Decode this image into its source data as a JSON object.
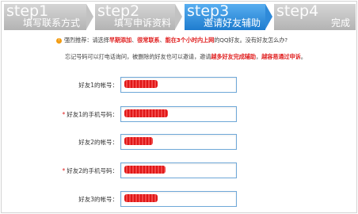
{
  "steps": [
    {
      "num": "step1",
      "label": "填写联系方式",
      "state": "done"
    },
    {
      "num": "step2",
      "label": "填写申诉资料",
      "state": "done"
    },
    {
      "num": "step3",
      "label": "邀请好友辅助",
      "state": "current"
    },
    {
      "num": "step4",
      "label": "完成",
      "state": "pending"
    }
  ],
  "tip": {
    "icon": "lightbulb-icon",
    "p1": "强烈推荐：请选择",
    "h1": "早期添加",
    "p2": "、",
    "h2": "很常联系",
    "p3": "、",
    "h3": "能在3个小时内上网",
    "p4": "的QQ好友。没有好友怎么办?"
  },
  "note": {
    "p1": "忘记号码可以打电话询问，被删除的好友也可以邀请，邀请",
    "h1": "越多好友完成辅助",
    "p2": "，",
    "h2": "越容易通过申诉",
    "p3": "。"
  },
  "form": [
    {
      "label": "好友1的帐号：",
      "required": false,
      "value": "●●●●●●●●●"
    },
    {
      "label": "好友1的手机号码：",
      "required": true,
      "value": "●●●●●●●●●●●"
    },
    {
      "label": "好友2的帐号：",
      "required": false,
      "value": "●●●●●●●●"
    },
    {
      "label": "好友2的手机号码：",
      "required": true,
      "value": "●●●●●●●●●●●"
    },
    {
      "label": "好友3的帐号：",
      "required": false,
      "value": "●●●●●●●●●"
    }
  ],
  "colors": {
    "active_step": "#2a86d6",
    "inactive_step": "#c4c4c4",
    "highlight": "#e02020",
    "field_border": "#6fa8d8"
  }
}
